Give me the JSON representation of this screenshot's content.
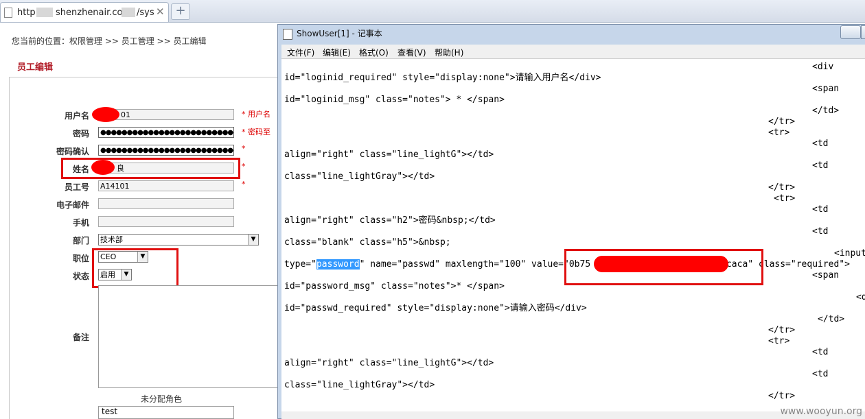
{
  "browser": {
    "tab_url_prefix": "http:",
    "tab_url_mid": "shenzhenair.com/",
    "tab_url_suffix": "/sys",
    "tab_close": "✕",
    "new_tab": "+"
  },
  "page": {
    "breadcrumb": "您当前的位置：权限管理 >> 员工管理 >> 员工编辑",
    "title": "员工编辑",
    "form": {
      "username_label": "用户名",
      "username_value": "01",
      "username_hint": "* 用户名",
      "password_label": "密码",
      "password_value": "●●●●●●●●●●●●●●●●●●●●●●●●●●●●●",
      "password_hint": "* 密码至",
      "confirm_label": "密码确认",
      "confirm_value": "●●●●●●●●●●●●●●●●●●●●●●●●●●●●●",
      "confirm_hint": "*",
      "name_label": "姓名",
      "name_value": "良",
      "name_hint": "*",
      "empno_label": "员工号",
      "empno_value": "A14101",
      "empno_hint": "*",
      "email_label": "电子邮件",
      "email_value": "",
      "mobile_label": "手机",
      "mobile_value": "",
      "dept_label": "部门",
      "dept_value": "技术部",
      "position_label": "职位",
      "position_value": "CEO",
      "status_label": "状态",
      "status_value": "启用",
      "remark_label": "备注",
      "unassigned_roles_label": "未分配角色",
      "role_option": "test"
    }
  },
  "notepad": {
    "title": "ShowUser[1] - 记事本",
    "menus": [
      "文件(F)",
      "编辑(E)",
      "格式(O)",
      "查看(V)",
      "帮助(H)"
    ],
    "lines": [
      {
        "text": "<div",
        "indent": 769,
        "row": 0
      },
      {
        "text": "id=\"loginid_required\" style=\"display:none\">请输入用户名</div>",
        "indent": 0,
        "row": 1
      },
      {
        "text": "<span",
        "indent": 769,
        "row": 2
      },
      {
        "text": "id=\"loginid_msg\" class=\"notes\"> * </span>",
        "indent": 0,
        "row": 3
      },
      {
        "text": "</td>",
        "indent": 769,
        "row": 4
      },
      {
        "text": "</tr>",
        "indent": 705,
        "row": 5
      },
      {
        "text": "<tr>",
        "indent": 705,
        "row": 6
      },
      {
        "text": "<td",
        "indent": 769,
        "row": 7
      },
      {
        "text": "align=\"right\" class=\"line_lightG\"></td>",
        "indent": 0,
        "row": 8
      },
      {
        "text": "<td",
        "indent": 769,
        "row": 9
      },
      {
        "text": "class=\"line_lightGray\"></td>",
        "indent": 0,
        "row": 10
      },
      {
        "text": "</tr>",
        "indent": 705,
        "row": 11
      },
      {
        "text": "<tr>",
        "indent": 713,
        "row": 12
      },
      {
        "text": "<td",
        "indent": 769,
        "row": 13
      },
      {
        "text": "align=\"right\" class=\"h2\">密码&nbsp;</td>",
        "indent": 0,
        "row": 14
      },
      {
        "text": "<td",
        "indent": 769,
        "row": 15
      },
      {
        "text": "class=\"blank\" class=\"h5\">&nbsp;",
        "indent": 0,
        "row": 16
      },
      {
        "text": "<input",
        "indent": 801,
        "row": 17
      },
      {
        "text": "<span",
        "indent": 769,
        "row": 19
      },
      {
        "text": "id=\"password_msg\" class=\"notes\">* </span>",
        "indent": 0,
        "row": 20
      },
      {
        "text": "<d",
        "indent": 833,
        "row": 21
      },
      {
        "text": "id=\"passwd_required\" style=\"display:none\">请输入密码</div>",
        "indent": 0,
        "row": 22
      },
      {
        "text": "</td>",
        "indent": 777,
        "row": 23
      },
      {
        "text": "</tr>",
        "indent": 705,
        "row": 24
      },
      {
        "text": "<tr>",
        "indent": 705,
        "row": 25
      },
      {
        "text": "<td",
        "indent": 769,
        "row": 26
      },
      {
        "text": "align=\"right\" class=\"line_lightG\"></td>",
        "indent": 0,
        "row": 27
      },
      {
        "text": "<td",
        "indent": 769,
        "row": 28
      },
      {
        "text": "class=\"line_lightGray\"></td>",
        "indent": 0,
        "row": 29
      },
      {
        "text": "</tr>",
        "indent": 705,
        "row": 30
      }
    ],
    "password_line": {
      "pre": "type=\"",
      "selected": "password",
      "mid": "\" name=\"passwd\" maxlength=\"100\" value=\"0b75",
      "tail": "3caca\" class=\"required\">"
    }
  },
  "watermark": "www.wooyun.org",
  "colors": {
    "redact": "#ff0000",
    "highlight_box": "#e01010",
    "title_red": "#b3202b",
    "selection": "#3399ff"
  }
}
